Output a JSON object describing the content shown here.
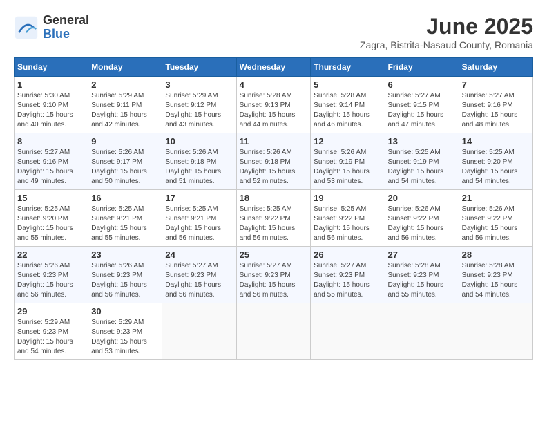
{
  "header": {
    "logo": {
      "general": "General",
      "blue": "Blue"
    },
    "title": "June 2025",
    "location": "Zagra, Bistrita-Nasaud County, Romania"
  },
  "calendar": {
    "weekdays": [
      "Sunday",
      "Monday",
      "Tuesday",
      "Wednesday",
      "Thursday",
      "Friday",
      "Saturday"
    ],
    "weeks": [
      [
        {
          "day": "1",
          "sunrise": "5:30 AM",
          "sunset": "9:10 PM",
          "daylight": "15 hours and 40 minutes."
        },
        {
          "day": "2",
          "sunrise": "5:29 AM",
          "sunset": "9:11 PM",
          "daylight": "15 hours and 42 minutes."
        },
        {
          "day": "3",
          "sunrise": "5:29 AM",
          "sunset": "9:12 PM",
          "daylight": "15 hours and 43 minutes."
        },
        {
          "day": "4",
          "sunrise": "5:28 AM",
          "sunset": "9:13 PM",
          "daylight": "15 hours and 44 minutes."
        },
        {
          "day": "5",
          "sunrise": "5:28 AM",
          "sunset": "9:14 PM",
          "daylight": "15 hours and 46 minutes."
        },
        {
          "day": "6",
          "sunrise": "5:27 AM",
          "sunset": "9:15 PM",
          "daylight": "15 hours and 47 minutes."
        },
        {
          "day": "7",
          "sunrise": "5:27 AM",
          "sunset": "9:16 PM",
          "daylight": "15 hours and 48 minutes."
        }
      ],
      [
        {
          "day": "8",
          "sunrise": "5:27 AM",
          "sunset": "9:16 PM",
          "daylight": "15 hours and 49 minutes."
        },
        {
          "day": "9",
          "sunrise": "5:26 AM",
          "sunset": "9:17 PM",
          "daylight": "15 hours and 50 minutes."
        },
        {
          "day": "10",
          "sunrise": "5:26 AM",
          "sunset": "9:18 PM",
          "daylight": "15 hours and 51 minutes."
        },
        {
          "day": "11",
          "sunrise": "5:26 AM",
          "sunset": "9:18 PM",
          "daylight": "15 hours and 52 minutes."
        },
        {
          "day": "12",
          "sunrise": "5:26 AM",
          "sunset": "9:19 PM",
          "daylight": "15 hours and 53 minutes."
        },
        {
          "day": "13",
          "sunrise": "5:25 AM",
          "sunset": "9:19 PM",
          "daylight": "15 hours and 54 minutes."
        },
        {
          "day": "14",
          "sunrise": "5:25 AM",
          "sunset": "9:20 PM",
          "daylight": "15 hours and 54 minutes."
        }
      ],
      [
        {
          "day": "15",
          "sunrise": "5:25 AM",
          "sunset": "9:20 PM",
          "daylight": "15 hours and 55 minutes."
        },
        {
          "day": "16",
          "sunrise": "5:25 AM",
          "sunset": "9:21 PM",
          "daylight": "15 hours and 55 minutes."
        },
        {
          "day": "17",
          "sunrise": "5:25 AM",
          "sunset": "9:21 PM",
          "daylight": "15 hours and 56 minutes."
        },
        {
          "day": "18",
          "sunrise": "5:25 AM",
          "sunset": "9:22 PM",
          "daylight": "15 hours and 56 minutes."
        },
        {
          "day": "19",
          "sunrise": "5:25 AM",
          "sunset": "9:22 PM",
          "daylight": "15 hours and 56 minutes."
        },
        {
          "day": "20",
          "sunrise": "5:26 AM",
          "sunset": "9:22 PM",
          "daylight": "15 hours and 56 minutes."
        },
        {
          "day": "21",
          "sunrise": "5:26 AM",
          "sunset": "9:22 PM",
          "daylight": "15 hours and 56 minutes."
        }
      ],
      [
        {
          "day": "22",
          "sunrise": "5:26 AM",
          "sunset": "9:23 PM",
          "daylight": "15 hours and 56 minutes."
        },
        {
          "day": "23",
          "sunrise": "5:26 AM",
          "sunset": "9:23 PM",
          "daylight": "15 hours and 56 minutes."
        },
        {
          "day": "24",
          "sunrise": "5:27 AM",
          "sunset": "9:23 PM",
          "daylight": "15 hours and 56 minutes."
        },
        {
          "day": "25",
          "sunrise": "5:27 AM",
          "sunset": "9:23 PM",
          "daylight": "15 hours and 56 minutes."
        },
        {
          "day": "26",
          "sunrise": "5:27 AM",
          "sunset": "9:23 PM",
          "daylight": "15 hours and 55 minutes."
        },
        {
          "day": "27",
          "sunrise": "5:28 AM",
          "sunset": "9:23 PM",
          "daylight": "15 hours and 55 minutes."
        },
        {
          "day": "28",
          "sunrise": "5:28 AM",
          "sunset": "9:23 PM",
          "daylight": "15 hours and 54 minutes."
        }
      ],
      [
        {
          "day": "29",
          "sunrise": "5:29 AM",
          "sunset": "9:23 PM",
          "daylight": "15 hours and 54 minutes."
        },
        {
          "day": "30",
          "sunrise": "5:29 AM",
          "sunset": "9:23 PM",
          "daylight": "15 hours and 53 minutes."
        },
        null,
        null,
        null,
        null,
        null
      ]
    ]
  }
}
